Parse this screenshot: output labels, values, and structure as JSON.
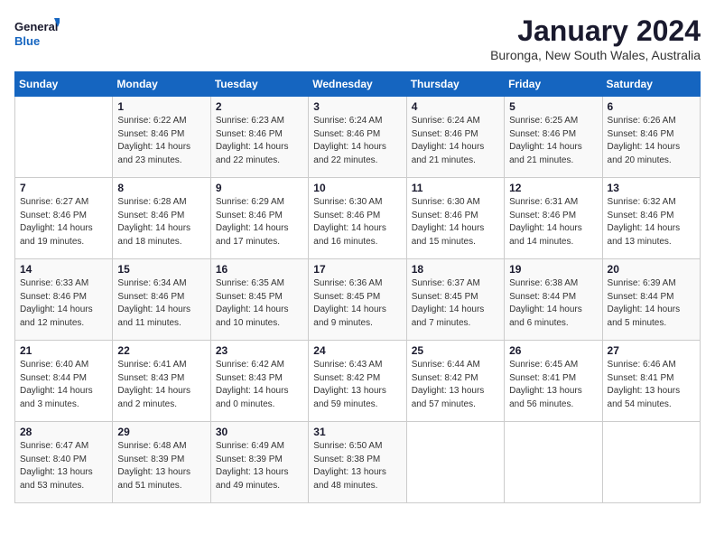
{
  "logo": {
    "line1": "General",
    "line2": "Blue"
  },
  "title": "January 2024",
  "subtitle": "Buronga, New South Wales, Australia",
  "days_of_week": [
    "Sunday",
    "Monday",
    "Tuesday",
    "Wednesday",
    "Thursday",
    "Friday",
    "Saturday"
  ],
  "weeks": [
    [
      {
        "num": "",
        "info": ""
      },
      {
        "num": "1",
        "info": "Sunrise: 6:22 AM\nSunset: 8:46 PM\nDaylight: 14 hours\nand 23 minutes."
      },
      {
        "num": "2",
        "info": "Sunrise: 6:23 AM\nSunset: 8:46 PM\nDaylight: 14 hours\nand 22 minutes."
      },
      {
        "num": "3",
        "info": "Sunrise: 6:24 AM\nSunset: 8:46 PM\nDaylight: 14 hours\nand 22 minutes."
      },
      {
        "num": "4",
        "info": "Sunrise: 6:24 AM\nSunset: 8:46 PM\nDaylight: 14 hours\nand 21 minutes."
      },
      {
        "num": "5",
        "info": "Sunrise: 6:25 AM\nSunset: 8:46 PM\nDaylight: 14 hours\nand 21 minutes."
      },
      {
        "num": "6",
        "info": "Sunrise: 6:26 AM\nSunset: 8:46 PM\nDaylight: 14 hours\nand 20 minutes."
      }
    ],
    [
      {
        "num": "7",
        "info": "Sunrise: 6:27 AM\nSunset: 8:46 PM\nDaylight: 14 hours\nand 19 minutes."
      },
      {
        "num": "8",
        "info": "Sunrise: 6:28 AM\nSunset: 8:46 PM\nDaylight: 14 hours\nand 18 minutes."
      },
      {
        "num": "9",
        "info": "Sunrise: 6:29 AM\nSunset: 8:46 PM\nDaylight: 14 hours\nand 17 minutes."
      },
      {
        "num": "10",
        "info": "Sunrise: 6:30 AM\nSunset: 8:46 PM\nDaylight: 14 hours\nand 16 minutes."
      },
      {
        "num": "11",
        "info": "Sunrise: 6:30 AM\nSunset: 8:46 PM\nDaylight: 14 hours\nand 15 minutes."
      },
      {
        "num": "12",
        "info": "Sunrise: 6:31 AM\nSunset: 8:46 PM\nDaylight: 14 hours\nand 14 minutes."
      },
      {
        "num": "13",
        "info": "Sunrise: 6:32 AM\nSunset: 8:46 PM\nDaylight: 14 hours\nand 13 minutes."
      }
    ],
    [
      {
        "num": "14",
        "info": "Sunrise: 6:33 AM\nSunset: 8:46 PM\nDaylight: 14 hours\nand 12 minutes."
      },
      {
        "num": "15",
        "info": "Sunrise: 6:34 AM\nSunset: 8:46 PM\nDaylight: 14 hours\nand 11 minutes."
      },
      {
        "num": "16",
        "info": "Sunrise: 6:35 AM\nSunset: 8:45 PM\nDaylight: 14 hours\nand 10 minutes."
      },
      {
        "num": "17",
        "info": "Sunrise: 6:36 AM\nSunset: 8:45 PM\nDaylight: 14 hours\nand 9 minutes."
      },
      {
        "num": "18",
        "info": "Sunrise: 6:37 AM\nSunset: 8:45 PM\nDaylight: 14 hours\nand 7 minutes."
      },
      {
        "num": "19",
        "info": "Sunrise: 6:38 AM\nSunset: 8:44 PM\nDaylight: 14 hours\nand 6 minutes."
      },
      {
        "num": "20",
        "info": "Sunrise: 6:39 AM\nSunset: 8:44 PM\nDaylight: 14 hours\nand 5 minutes."
      }
    ],
    [
      {
        "num": "21",
        "info": "Sunrise: 6:40 AM\nSunset: 8:44 PM\nDaylight: 14 hours\nand 3 minutes."
      },
      {
        "num": "22",
        "info": "Sunrise: 6:41 AM\nSunset: 8:43 PM\nDaylight: 14 hours\nand 2 minutes."
      },
      {
        "num": "23",
        "info": "Sunrise: 6:42 AM\nSunset: 8:43 PM\nDaylight: 14 hours\nand 0 minutes."
      },
      {
        "num": "24",
        "info": "Sunrise: 6:43 AM\nSunset: 8:42 PM\nDaylight: 13 hours\nand 59 minutes."
      },
      {
        "num": "25",
        "info": "Sunrise: 6:44 AM\nSunset: 8:42 PM\nDaylight: 13 hours\nand 57 minutes."
      },
      {
        "num": "26",
        "info": "Sunrise: 6:45 AM\nSunset: 8:41 PM\nDaylight: 13 hours\nand 56 minutes."
      },
      {
        "num": "27",
        "info": "Sunrise: 6:46 AM\nSunset: 8:41 PM\nDaylight: 13 hours\nand 54 minutes."
      }
    ],
    [
      {
        "num": "28",
        "info": "Sunrise: 6:47 AM\nSunset: 8:40 PM\nDaylight: 13 hours\nand 53 minutes."
      },
      {
        "num": "29",
        "info": "Sunrise: 6:48 AM\nSunset: 8:39 PM\nDaylight: 13 hours\nand 51 minutes."
      },
      {
        "num": "30",
        "info": "Sunrise: 6:49 AM\nSunset: 8:39 PM\nDaylight: 13 hours\nand 49 minutes."
      },
      {
        "num": "31",
        "info": "Sunrise: 6:50 AM\nSunset: 8:38 PM\nDaylight: 13 hours\nand 48 minutes."
      },
      {
        "num": "",
        "info": ""
      },
      {
        "num": "",
        "info": ""
      },
      {
        "num": "",
        "info": ""
      }
    ]
  ]
}
